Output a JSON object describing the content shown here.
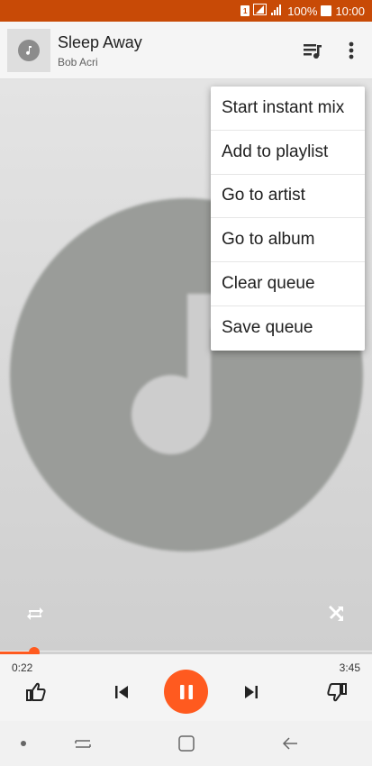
{
  "status_bar": {
    "battery": "100%",
    "time": "10:00",
    "sim_badge": "1"
  },
  "now_playing": {
    "title": "Sleep Away",
    "artist": "Bob Acri"
  },
  "progress": {
    "elapsed": "0:22",
    "total": "3:45",
    "fraction": 0.092
  },
  "menu": {
    "items": [
      {
        "label": "Start instant mix"
      },
      {
        "label": "Add to playlist"
      },
      {
        "label": "Go to artist"
      },
      {
        "label": "Go to album"
      },
      {
        "label": "Clear queue"
      },
      {
        "label": "Save queue"
      }
    ]
  },
  "icons": {
    "thumb": "music-note-icon",
    "queue": "queue-music-icon",
    "more": "more-vert-icon",
    "repeat": "repeat-icon",
    "shuffle": "shuffle-icon",
    "like": "thumb-up-icon",
    "prev": "skip-previous-icon",
    "play_pause": "pause-icon",
    "next": "skip-next-icon",
    "dislike": "thumb-down-icon"
  },
  "colors": {
    "accent": "#ff5a1f",
    "status_bar": "#c84a06"
  }
}
